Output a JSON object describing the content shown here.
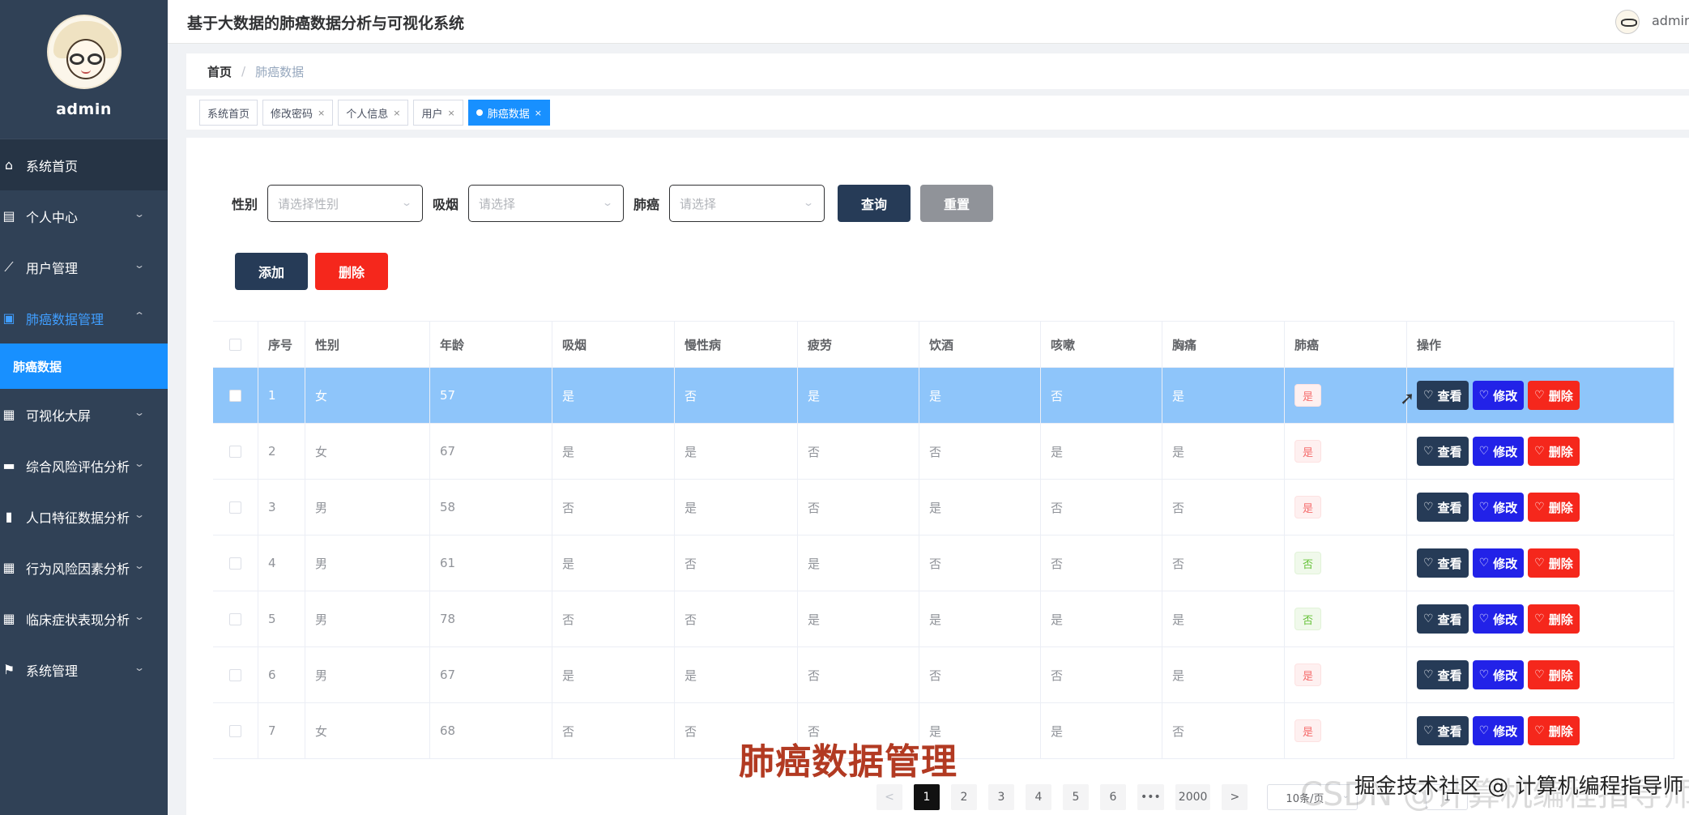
{
  "app": {
    "title": "基于大数据的肺癌数据分析与可视化系统",
    "user": "admin"
  },
  "sidebar": {
    "username": "admin",
    "items": [
      {
        "label": "系统首页",
        "icon": "home-icon"
      },
      {
        "label": "个人中心",
        "icon": "user-card-icon"
      },
      {
        "label": "用户管理",
        "icon": "trend-icon"
      },
      {
        "label": "肺癌数据管理",
        "icon": "data-icon"
      },
      {
        "label": "肺癌数据",
        "icon": ""
      },
      {
        "label": "可视化大屏",
        "icon": "grid-icon"
      },
      {
        "label": "综合风险评估分析",
        "icon": "chat-icon"
      },
      {
        "label": "人口特征数据分析",
        "icon": "bar-chart-icon"
      },
      {
        "label": "行为风险因素分析",
        "icon": "grid-icon"
      },
      {
        "label": "临床症状表现分析",
        "icon": "grid-icon"
      },
      {
        "label": "系统管理",
        "icon": "flag-icon"
      }
    ]
  },
  "breadcrumb": {
    "home": "首页",
    "sep": "/",
    "current": "肺癌数据"
  },
  "tags": [
    "系统首页",
    "修改密码",
    "个人信息",
    "用户",
    "肺癌数据"
  ],
  "filters": {
    "gender_label": "性别",
    "gender_placeholder": "请选择性别",
    "smoke_label": "吸烟",
    "smoke_placeholder": "请选择",
    "cancer_label": "肺癌",
    "cancer_placeholder": "请选择",
    "query": "查询",
    "reset": "重置"
  },
  "actions": {
    "add": "添加",
    "delete": "删除"
  },
  "table": {
    "headers": [
      "序号",
      "性别",
      "年龄",
      "吸烟",
      "慢性病",
      "疲劳",
      "饮酒",
      "咳嗽",
      "胸痛",
      "肺癌",
      "操作"
    ],
    "rows": [
      [
        "1",
        "女",
        "57",
        "是",
        "否",
        "是",
        "是",
        "否",
        "是",
        "是"
      ],
      [
        "2",
        "女",
        "67",
        "是",
        "是",
        "否",
        "否",
        "是",
        "是",
        "是"
      ],
      [
        "3",
        "男",
        "58",
        "否",
        "是",
        "否",
        "是",
        "否",
        "否",
        "是"
      ],
      [
        "4",
        "男",
        "61",
        "是",
        "否",
        "是",
        "否",
        "否",
        "否",
        "否"
      ],
      [
        "5",
        "男",
        "78",
        "否",
        "否",
        "是",
        "是",
        "是",
        "是",
        "否"
      ],
      [
        "6",
        "男",
        "67",
        "是",
        "是",
        "否",
        "否",
        "否",
        "是",
        "是"
      ],
      [
        "7",
        "女",
        "68",
        "否",
        "否",
        "否",
        "是",
        "是",
        "否",
        "是"
      ]
    ],
    "btn_view": "查看",
    "btn_edit": "修改",
    "btn_delete": "删除"
  },
  "pagination": {
    "prev": "<",
    "pages": [
      "1",
      "2",
      "3",
      "4",
      "5",
      "6"
    ],
    "ellipsis": "•••",
    "last": "2000",
    "next": ">",
    "size": "10条/页",
    "jump": "1"
  },
  "overlay": {
    "title": "肺癌数据管理",
    "watermark_bg": "CSDN @计算机编程指导师",
    "watermark": "掘金技术社区 @ 计算机编程指导师"
  },
  "colors": {
    "sidebar": "#304156",
    "accent": "#1890ff",
    "primary_btn": "#263b57",
    "danger": "#f5271c",
    "edit": "#2222e8"
  }
}
